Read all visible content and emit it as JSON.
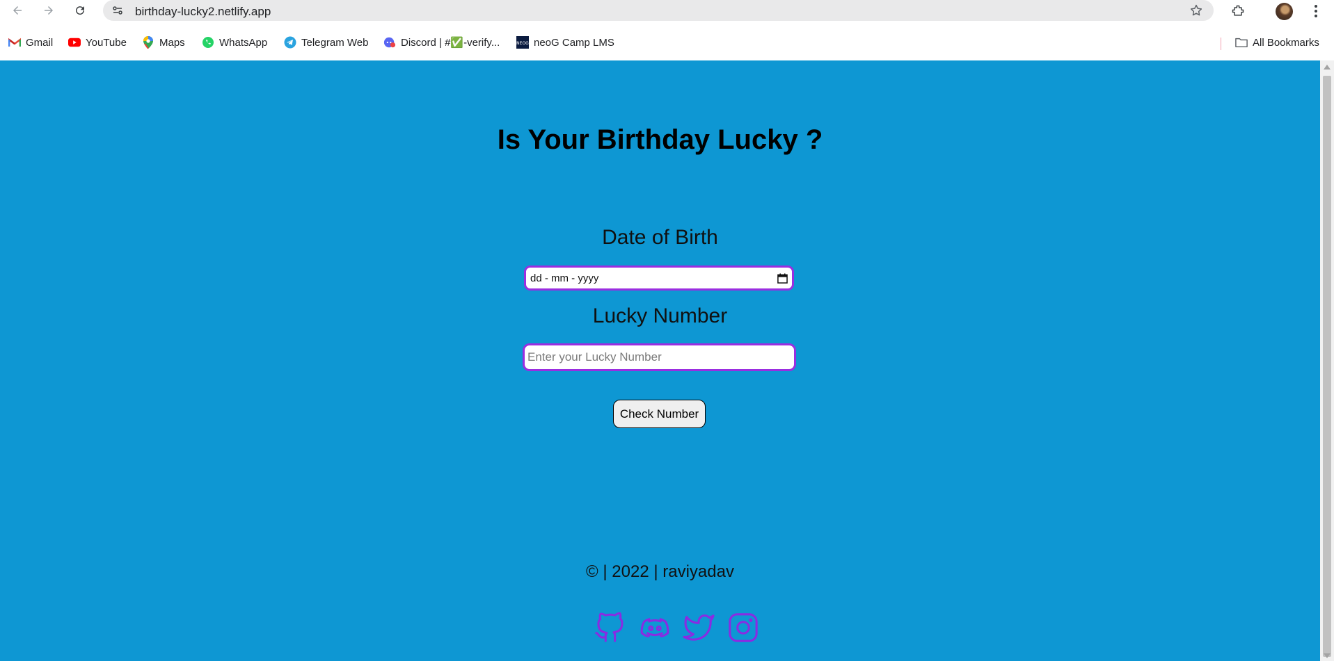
{
  "browser": {
    "url": "birthday-lucky2.netlify.app",
    "icons": [
      "back-arrow-icon",
      "forward-arrow-icon",
      "reload-icon",
      "site-settings-icon",
      "bookmark-star-icon",
      "extensions-icon",
      "profile-avatar",
      "more-menu-icon"
    ]
  },
  "bookmarks": {
    "items": [
      {
        "label": "Gmail",
        "icon": "gmail-icon"
      },
      {
        "label": "YouTube",
        "icon": "youtube-icon"
      },
      {
        "label": "Maps",
        "icon": "maps-icon"
      },
      {
        "label": "WhatsApp",
        "icon": "whatsapp-icon"
      },
      {
        "label": "Telegram Web",
        "icon": "telegram-icon"
      },
      {
        "label": "Discord | #✅-verify...",
        "icon": "discord-icon"
      },
      {
        "label": "neoG Camp LMS",
        "icon": "neog-icon"
      }
    ],
    "all_label": "All Bookmarks"
  },
  "page": {
    "title": "Is Your Birthday Lucky ?",
    "dob_label": "Date of Birth",
    "dob_value": "dd - mm - yyyy",
    "lucky_label": "Lucky Number",
    "lucky_placeholder": "Enter your Lucky Number",
    "check_button": "Check Number",
    "footer": "© | 2022 | raviyadav",
    "social_icons": [
      "github-icon",
      "discord-icon",
      "twitter-icon",
      "instagram-icon"
    ]
  },
  "colors": {
    "background": "#0e97d3",
    "accent": "#8a2be2",
    "input_border": "#9b2ee0"
  }
}
